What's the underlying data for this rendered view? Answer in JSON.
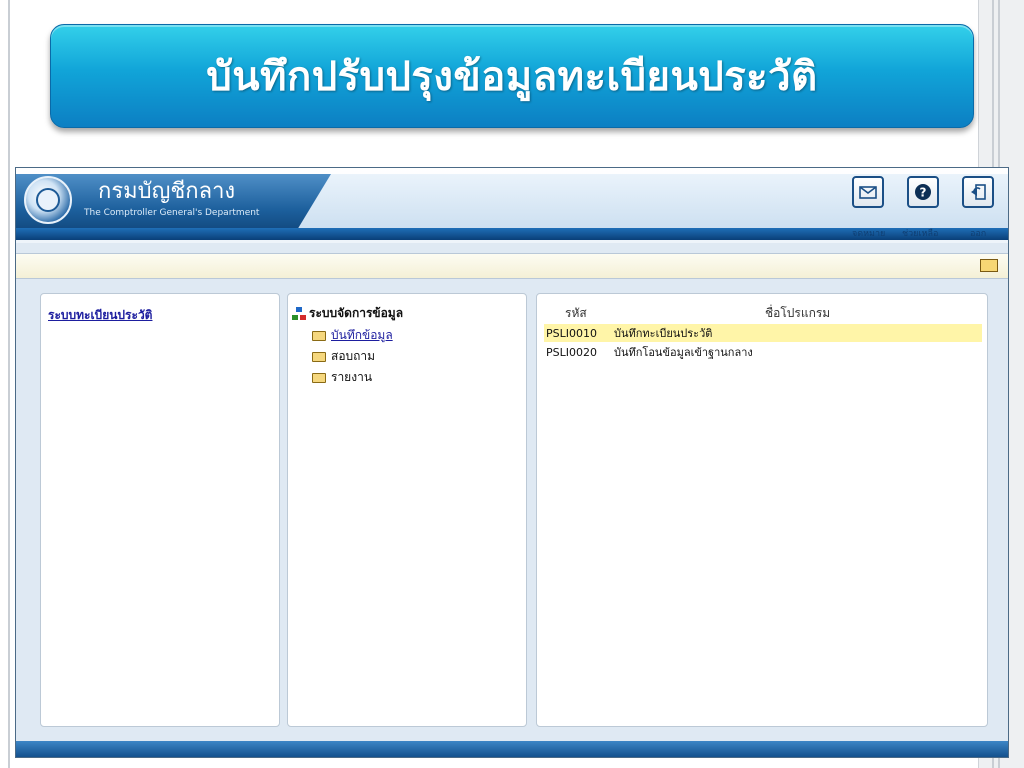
{
  "slide": {
    "title": "บันทึกปรับปรุงข้อมูลทะเบียนประวัติ"
  },
  "header": {
    "org_name_th": "กรมบัญชีกลาง",
    "org_name_en": "The Comptroller General's Department",
    "buttons": [
      {
        "label": "จดหมาย",
        "icon": "mail-icon"
      },
      {
        "label": "ช่วยเหลือ",
        "icon": "help-icon"
      },
      {
        "label": "ออก",
        "icon": "exit-icon"
      }
    ]
  },
  "left_panel": {
    "system_link": "ระบบทะเบียนประวัติ"
  },
  "middle_panel": {
    "root_label": "ระบบจัดการข้อมูล",
    "items": [
      {
        "label": "บันทึกข้อมูล",
        "active": true
      },
      {
        "label": "สอบถาม",
        "active": false
      },
      {
        "label": "รายงาน",
        "active": false
      }
    ]
  },
  "right_panel": {
    "columns": [
      "รหัส",
      "ชื่อโปรแกรม"
    ],
    "rows": [
      {
        "code": "PSLI0010",
        "name": "บันทึกทะเบียนประวัติ",
        "highlighted": true
      },
      {
        "code": "PSLI0020",
        "name": "บันทึกโอนข้อมูลเข้าฐานกลาง",
        "highlighted": false
      }
    ]
  },
  "colors": {
    "banner": "#11a4d8",
    "header": "#1c5f9c",
    "highlight_row": "#fff5a8",
    "link": "#1d1e9f"
  }
}
